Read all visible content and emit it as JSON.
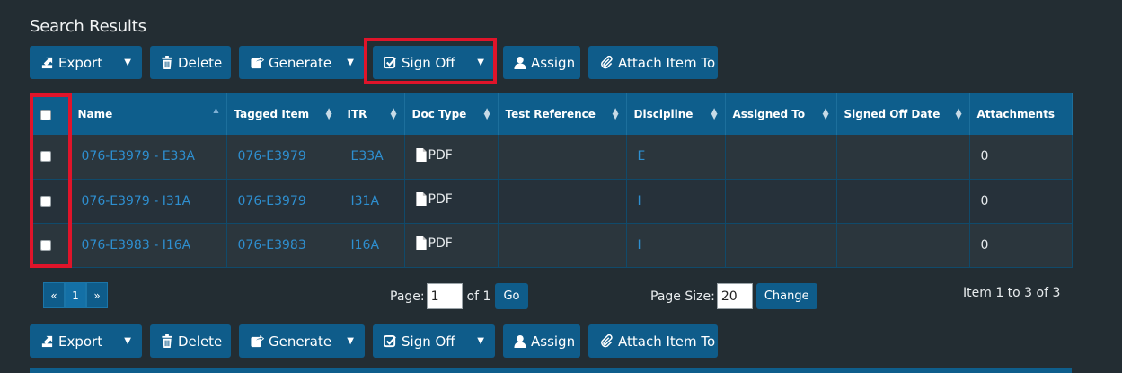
{
  "title": "Search Results",
  "toolbar": {
    "export": "Export",
    "delete": "Delete",
    "generate": "Generate",
    "signoff": "Sign Off",
    "assign": "Assign",
    "attach": "Attach Item To"
  },
  "table": {
    "headers": [
      "Name",
      "Tagged Item",
      "ITR",
      "Doc Type",
      "Test Reference",
      "Discipline",
      "Assigned To",
      "Signed Off Date",
      "Attachments"
    ],
    "rows": [
      {
        "name": "076-E3979 - E33A",
        "tagged": "076-E3979",
        "itr": "E33A",
        "doc": "PDF",
        "test": "",
        "discipline": "E",
        "assigned": "",
        "signed": "",
        "attachments": "0"
      },
      {
        "name": "076-E3979 - I31A",
        "tagged": "076-E3979",
        "itr": "I31A",
        "doc": "PDF",
        "test": "",
        "discipline": "I",
        "assigned": "",
        "signed": "",
        "attachments": "0"
      },
      {
        "name": "076-E3983 - I16A",
        "tagged": "076-E3983",
        "itr": "I16A",
        "doc": "PDF",
        "test": "",
        "discipline": "I",
        "assigned": "",
        "signed": "",
        "attachments": "0"
      }
    ]
  },
  "pager": {
    "first": "«",
    "current": "1",
    "last": "»",
    "page_label": "Page:",
    "page_value": "1",
    "of_label": "of 1",
    "go": "Go",
    "size_label": "Page Size:",
    "size_value": "20",
    "change": "Change",
    "item_count": "Item 1 to 3 of 3"
  },
  "colors": {
    "background": "#232d33",
    "primary": "#0f5c8a",
    "link": "#2e8fd0",
    "highlight": "#e0142a"
  }
}
